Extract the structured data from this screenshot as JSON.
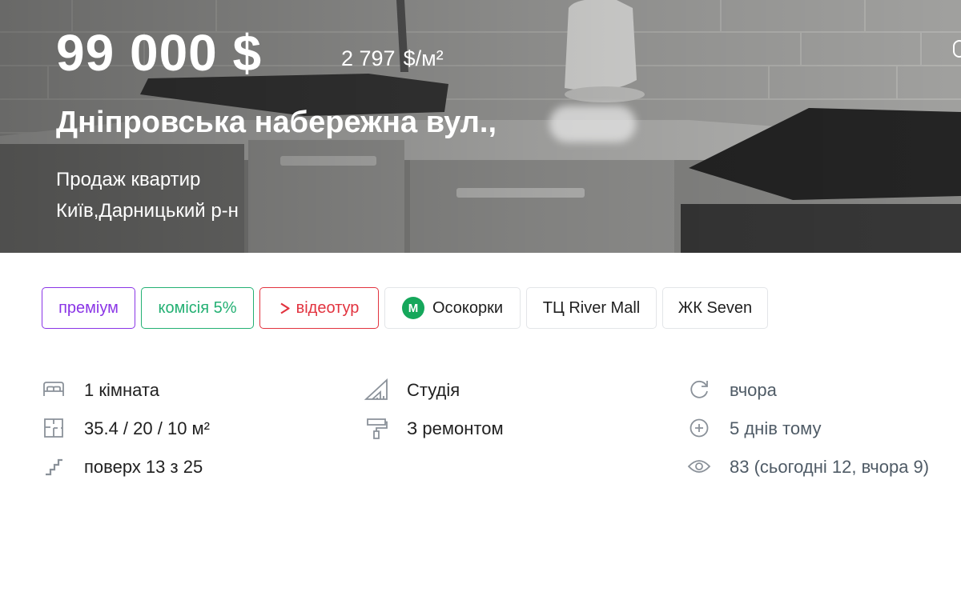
{
  "hero": {
    "price": "99 000 $",
    "price_per_sqm_value": "2 797",
    "price_per_sqm_unit": "$/м²",
    "address": "Дніпровська набережна вул.,",
    "deal_type": "Продаж квартир",
    "location": "Київ,Дарницький р-н"
  },
  "tags": {
    "premium": "преміум",
    "commission": "комісія 5%",
    "video": "відеотур",
    "metro_letter": "М",
    "metro": "Осокорки",
    "mall": "ТЦ River Mall",
    "complex": "ЖК Seven"
  },
  "details": {
    "rooms": "1 кімната",
    "area": "35.4 / 20 / 10 м²",
    "floor": "поверх 13 з 25",
    "layout": "Студія",
    "renovation": "З ремонтом",
    "updated": "вчора",
    "created": "5 днів тому",
    "views": "83 (сьогодні 12, вчора 9)"
  },
  "colors": {
    "premium": "#8a35e6",
    "commission": "#23b073",
    "video": "#e2333f",
    "metro": "#15a75b",
    "icon_gray": "#8a9199"
  },
  "icons": [
    "bed-icon",
    "floorplan-icon",
    "stairs-icon",
    "triangle-ruler-icon",
    "paint-roller-icon",
    "refresh-icon",
    "plus-circle-icon",
    "eye-icon",
    "play-icon"
  ]
}
